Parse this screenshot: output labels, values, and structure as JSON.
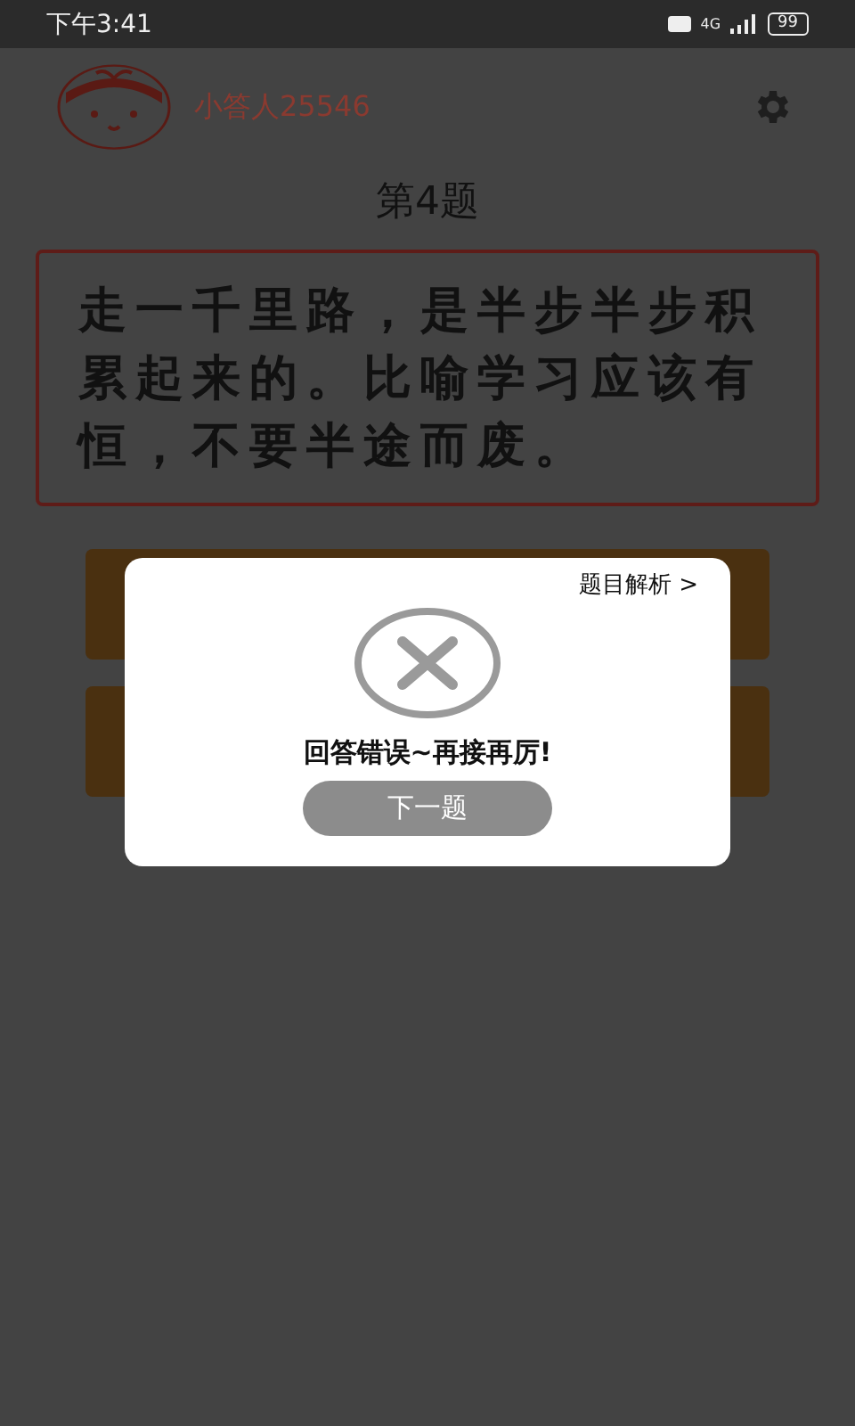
{
  "status_bar": {
    "time": "下午3:41",
    "network": "4G",
    "battery": "99"
  },
  "header": {
    "username": "小答人25546"
  },
  "question": {
    "title": "第4题",
    "text": "走一千里路，是半步半步积累起来的。比喻学习应该有恒，不要半途而废。"
  },
  "dialog": {
    "analysis_link": "题目解析 >",
    "message": "回答错误~再接再厉!",
    "next_button": "下一题"
  }
}
